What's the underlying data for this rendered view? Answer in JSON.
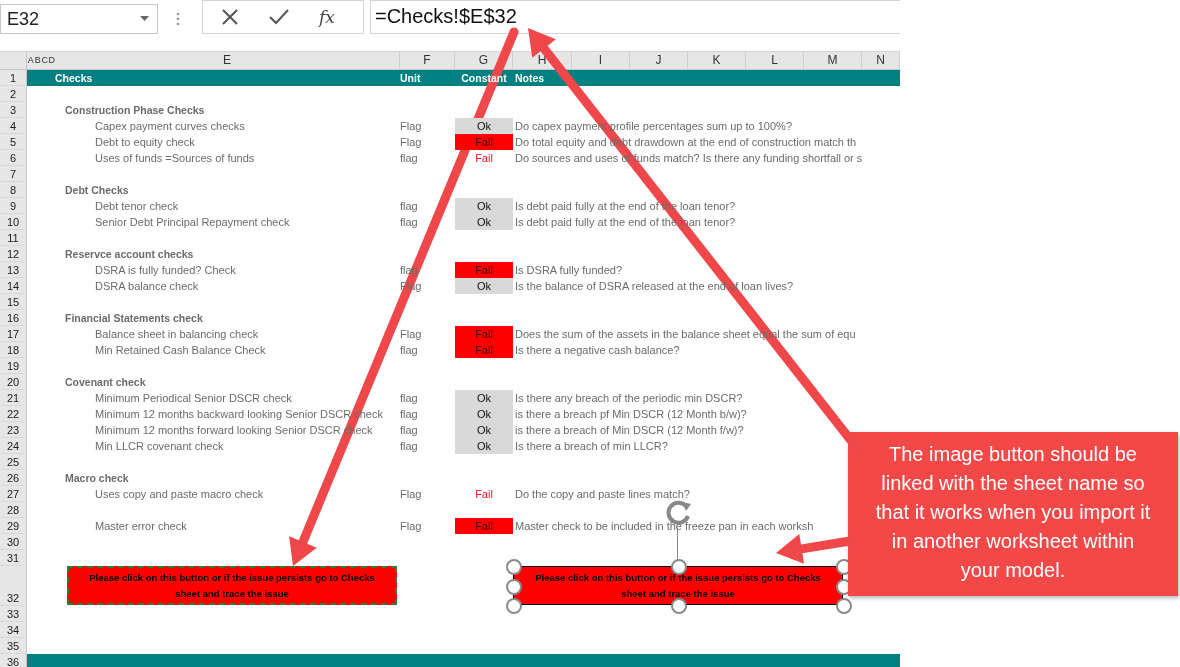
{
  "formula_bar": {
    "name_box": "E32",
    "fx_label": "fx",
    "formula": "=Checks!$E$32"
  },
  "columns": [
    "A",
    "B",
    "C",
    "D",
    "E",
    "F",
    "G",
    "H",
    "I",
    "J",
    "K",
    "L",
    "M",
    "N"
  ],
  "rows": [
    {
      "number": "1",
      "kind": "header",
      "label": "Checks",
      "unit": "Unit",
      "result": "Constant",
      "note": "Notes"
    },
    {
      "number": "2",
      "kind": "blank"
    },
    {
      "number": "3",
      "kind": "section",
      "label": "Construction Phase Checks"
    },
    {
      "number": "4",
      "kind": "check",
      "label": "Capex payment curves checks",
      "unit": "Flag",
      "result": "Ok",
      "failed": false,
      "filled": true,
      "note": "Do capex payment profile percentages sum up to 100%?"
    },
    {
      "number": "5",
      "kind": "check",
      "label": "Debt to equity check",
      "unit": "Flag",
      "result": "Fail",
      "failed": true,
      "filled": true,
      "note": "Do total equity and debt drawdown at the end of construction match th"
    },
    {
      "number": "6",
      "kind": "check",
      "label": "Uses of funds =Sources of funds",
      "unit": "flag",
      "result": "Fail",
      "failed": true,
      "filled": false,
      "note": "Do sources and uses of funds match? Is there any funding shortfall or s"
    },
    {
      "number": "7",
      "kind": "blank"
    },
    {
      "number": "8",
      "kind": "section",
      "label": "Debt Checks"
    },
    {
      "number": "9",
      "kind": "check",
      "label": "Debt tenor check",
      "unit": "flag",
      "result": "Ok",
      "failed": false,
      "filled": true,
      "note": "Is debt paid fully at the end of the loan tenor?"
    },
    {
      "number": "10",
      "kind": "check",
      "label": "Senior Debt  Principal Repayment  check",
      "unit": "flag",
      "result": "Ok",
      "failed": false,
      "filled": true,
      "note": "Is debt paid fully at the end of the loan tenor?"
    },
    {
      "number": "11",
      "kind": "blank"
    },
    {
      "number": "12",
      "kind": "section",
      "label": "Reservce account checks"
    },
    {
      "number": "13",
      "kind": "check",
      "label": "DSRA is fully funded? Check",
      "unit": "flag",
      "result": "Fail",
      "failed": true,
      "filled": true,
      "note": "Is DSRA fully funded?"
    },
    {
      "number": "14",
      "kind": "check",
      "label": "DSRA balance check",
      "unit": "Flag",
      "result": "Ok",
      "failed": false,
      "filled": true,
      "note": "Is the balance of DSRA released at the end of loan lives?"
    },
    {
      "number": "15",
      "kind": "blank"
    },
    {
      "number": "16",
      "kind": "section",
      "label": "Financial Statements check"
    },
    {
      "number": "17",
      "kind": "check",
      "label": "Balance sheet in balancing check",
      "unit": "Flag",
      "result": "Fail",
      "failed": true,
      "filled": true,
      "note": "Does the sum of the assets in the balance sheet equal the sum of equ"
    },
    {
      "number": "18",
      "kind": "check",
      "label": "Min Retained Cash Balance Check",
      "unit": "flag",
      "result": "Fail",
      "failed": true,
      "filled": true,
      "note": "Is there a negative cash balance?"
    },
    {
      "number": "19",
      "kind": "blank"
    },
    {
      "number": "20",
      "kind": "section",
      "label": "Covenant check"
    },
    {
      "number": "21",
      "kind": "check",
      "label": "Minimum  Periodical Senior DSCR check",
      "unit": "flag",
      "result": "Ok",
      "failed": false,
      "filled": true,
      "note": "Is there any breach of the periodic min DSCR?"
    },
    {
      "number": "22",
      "kind": "check",
      "label": "Minimum  12 months backward looking Senior DSCR check",
      "unit": "flag",
      "result": "Ok",
      "failed": false,
      "filled": true,
      "note": "is there a breach pf Min DSCR (12 Month b/w)?"
    },
    {
      "number": "23",
      "kind": "check",
      "label": "Minimum  12 months forward looking Senior DSCR check",
      "unit": "flag",
      "result": "Ok",
      "failed": false,
      "filled": true,
      "note": "is there a breach of Min DSCR (12 Month f/w)?"
    },
    {
      "number": "24",
      "kind": "check",
      "label": "Min LLCR covenant check",
      "unit": "flag",
      "result": "Ok",
      "failed": false,
      "filled": true,
      "note": "Is there a breach of min LLCR?"
    },
    {
      "number": "25",
      "kind": "blank"
    },
    {
      "number": "26",
      "kind": "section",
      "label": "Macro check"
    },
    {
      "number": "27",
      "kind": "check",
      "label": "Uses copy and paste macro check",
      "unit": "Flag",
      "result": "Fail",
      "failed": true,
      "filled": false,
      "note": "Do the copy and paste lines match?"
    },
    {
      "number": "28",
      "kind": "blank"
    },
    {
      "number": "29",
      "kind": "check",
      "label": "Master error check",
      "unit": "Flag",
      "result": "Fail",
      "failed": true,
      "filled": true,
      "note": "Master check to be included in the freeze pan in each worksh"
    },
    {
      "number": "30",
      "kind": "blank"
    },
    {
      "number": "31",
      "kind": "blank"
    },
    {
      "number": "32",
      "kind": "buttons",
      "buttons": [
        {
          "label": "Please click on this button or if the issue persists go to Checks sheet and trace the issue",
          "selected": false
        },
        {
          "label": "Please click on this button or if the issue persists go to Checks sheet and trace the issue",
          "selected": true
        }
      ]
    },
    {
      "number": "33",
      "kind": "blank"
    },
    {
      "number": "34",
      "kind": "blank"
    },
    {
      "number": "35",
      "kind": "blank"
    },
    {
      "number": "36",
      "kind": "footer"
    }
  ],
  "callout": {
    "text": "The image button should be linked with the sheet name so that it works when you import it in another worksheet within your model."
  }
}
